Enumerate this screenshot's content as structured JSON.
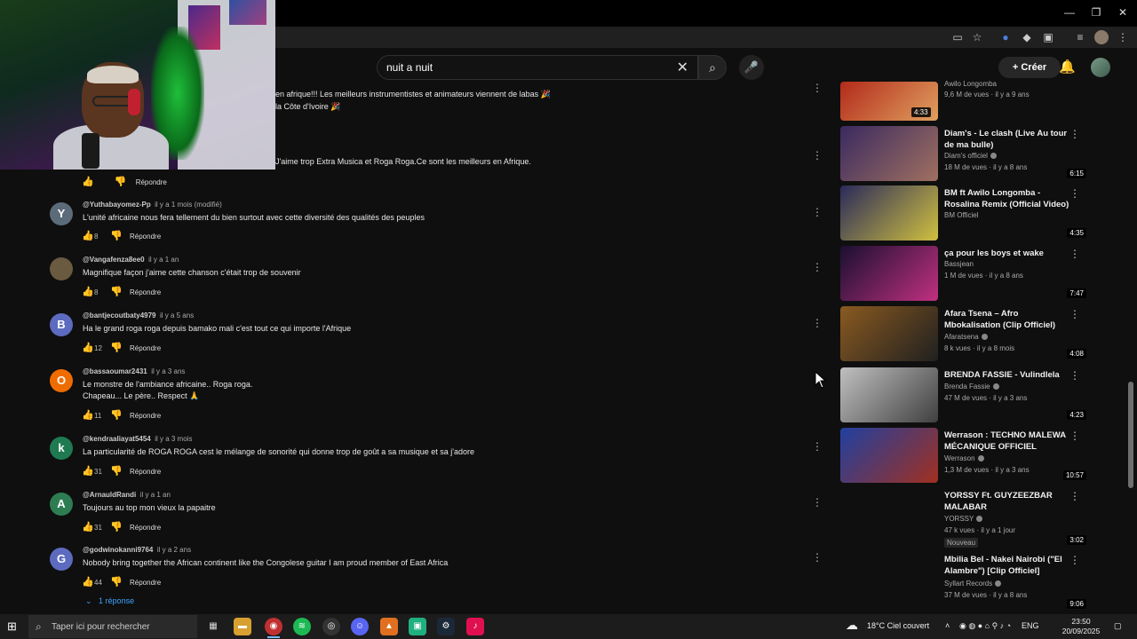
{
  "browser": {
    "window_controls": [
      "—",
      "❐",
      "✕"
    ]
  },
  "header": {
    "search_query": "nuit a nuit",
    "create_label": "Créer"
  },
  "partial_comments": [
    {
      "text": "en afrique!!! Les meilleurs instrumentistes et animateurs viennent de labas 🎉"
    },
    {
      "text": "la Côte d'Ivoire 🎉"
    },
    {
      "text": "J'aime trop Extra Musica et Roga Roga.Ce sont les meilleurs en Afrique."
    }
  ],
  "top_reply_label": "Répondre",
  "comments": [
    {
      "avatar_letter": "Y",
      "avatar_color": "#5c6b7a",
      "author": "@Yuthabayomez-Pp",
      "time": "il y a 1 mois (modifié)",
      "text": "L'unité africaine nous fera tellement du bien surtout avec cette diversité des qualités des peuples",
      "likes": "8",
      "reply": "Répondre"
    },
    {
      "avatar_letter": "",
      "avatar_color": "#6a5a40",
      "author": "@Vangafenza8ee0",
      "time": "il y a 1 an",
      "text": "Magnifique façon j'aime cette chanson c'était trop de souvenir",
      "likes": "8",
      "reply": "Répondre"
    },
    {
      "avatar_letter": "B",
      "avatar_color": "#5c6bc0",
      "author": "@bantjecoutbaty4979",
      "time": "il y a 5 ans",
      "text": "Ha le grand roga roga depuis bamako mali c'est tout ce qui importe l'Afrique",
      "likes": "12",
      "reply": "Répondre"
    },
    {
      "avatar_letter": "O",
      "avatar_color": "#ef6c00",
      "author": "@bassaoumar2431",
      "time": "il y a 3 ans",
      "text": "Le monstre de l'ambiance africaine.. Roga roga.",
      "text2": "Chapeau... Le père.. Respect 🙏",
      "likes": "11",
      "reply": "Répondre"
    },
    {
      "avatar_letter": "k",
      "avatar_color": "#1f7a52",
      "author": "@kendraaliayat5454",
      "time": "il y a 3 mois",
      "text": "La particularité de ROGA ROGA cest le mélange de sonorité qui donne trop de goût a sa musique et sa j'adore",
      "likes": "31",
      "reply": "Répondre"
    },
    {
      "avatar_letter": "A",
      "avatar_color": "#2e7d52",
      "author": "@ArnauldRandi",
      "time": "il y a 1 an",
      "text": "Toujours au top mon vieux la papaitre",
      "likes": "31",
      "reply": "Répondre"
    },
    {
      "avatar_letter": "G",
      "avatar_color": "#5c6bc0",
      "author": "@godwinokanni9764",
      "time": "il y a 2 ans",
      "text": "Nobody bring together the African continent like the Congolese guitar                  I am proud member of East Africa",
      "likes": "44",
      "reply": "Répondre"
    }
  ],
  "replies_link": "1 réponse",
  "sidebar": [
    {
      "title": "",
      "channel": "Awilo Longomba",
      "meta": "9,6 M de vues · il y a 9 ans",
      "duration": "4:33",
      "colors": [
        "#b22a1a",
        "#e0a060"
      ]
    },
    {
      "title": "Diam's - Le clash (Live Au tour de ma bulle)",
      "channel": "Diam's officiel",
      "meta": "18 M de vues · il y a 8 ans",
      "duration": "6:15",
      "colors": [
        "#3a2a60",
        "#a07060"
      ]
    },
    {
      "title": "BM ft Awilo Longomba - Rosalina Remix (Official Video)",
      "channel": "BM Officiel",
      "meta": "",
      "duration": "4:35",
      "colors": [
        "#2a2a5a",
        "#d0c040"
      ]
    },
    {
      "title": "ça pour les boys et wake",
      "channel": "Bassjean",
      "meta": "1 M de vues · il y a 8 ans",
      "duration": "7:47",
      "colors": [
        "#1a1030",
        "#c03080"
      ]
    },
    {
      "title": "Afara Tsena – Afro Mbokalisation (Clip Officiel)",
      "channel": "Afaratsena",
      "meta": "8 k vues · il y a 8 mois",
      "duration": "4:08",
      "colors": [
        "#8a5a20",
        "#202020"
      ]
    },
    {
      "title": "BRENDA FASSIE - Vulindlela",
      "channel": "Brenda Fassie",
      "meta": "47 M de vues · il y a 3 ans",
      "duration": "4:23",
      "colors": [
        "#c0c0c0",
        "#404040"
      ]
    },
    {
      "title": "Werrason : TECHNO MALEWA MÉCANIQUE OFFICIEL",
      "channel": "Werrason",
      "meta": "1,3 M de vues · il y a 3 ans",
      "duration": "10:57",
      "colors": [
        "#2040a0",
        "#a03020"
      ]
    },
    {
      "title": "YORSSY Ft. GUYZEEZBAR MALABAR",
      "channel": "YORSSY",
      "meta": "47 k vues · il y a 1 jour",
      "badge": "Nouveau",
      "duration": "3:02",
      "colors": [
        "#0f0f0f",
        "#0f0f0f"
      ]
    },
    {
      "title": "Mbilia Bel - Nakei Nairobi (\"El Alambre\") [Clip Officiel]",
      "channel": "Syllart Records",
      "meta": "37 M de vues · il y a 8 ans",
      "duration": "9:06",
      "colors": [
        "#0f0f0f",
        "#0f0f0f"
      ]
    }
  ],
  "taskbar": {
    "search_placeholder": "Taper ici pour rechercher",
    "weather": "18°C  Ciel couvert",
    "language": "ENG",
    "time": "23:50",
    "date": "20/09/2025"
  }
}
